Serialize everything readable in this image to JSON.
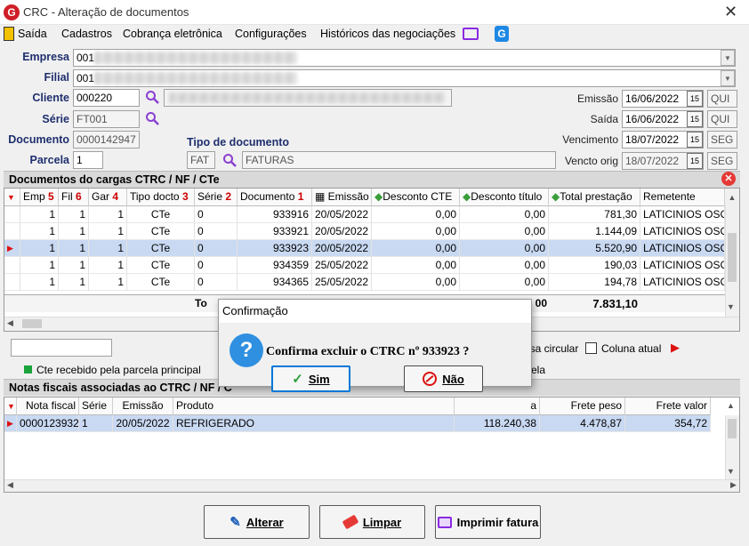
{
  "window": {
    "title": "CRC - Alteração de documentos"
  },
  "menu": [
    {
      "label": "Saída"
    },
    {
      "label": "Cadastros"
    },
    {
      "label": "Cobrança eletrônica"
    },
    {
      "label": "Configurações"
    },
    {
      "label": "Históricos das negociações"
    }
  ],
  "form": {
    "empresa": {
      "label": "Empresa",
      "value": "001"
    },
    "filial": {
      "label": "Filial",
      "value": "001"
    },
    "cliente": {
      "label": "Cliente",
      "value": "000220"
    },
    "serie": {
      "label": "Série",
      "value": "FT001"
    },
    "documento": {
      "label": "Documento",
      "value": "0000142947"
    },
    "parcela": {
      "label": "Parcela",
      "value": "1"
    },
    "tipo_documento": {
      "label": "Tipo de documento",
      "code": "FAT",
      "name": "FATURAS"
    },
    "emissao": {
      "label": "Emissão",
      "date": "16/06/2022",
      "day": "QUI"
    },
    "saida": {
      "label": "Saída",
      "date": "16/06/2022",
      "day": "QUI"
    },
    "vencimento": {
      "label": "Vencimento",
      "date": "18/07/2022",
      "day": "SEG"
    },
    "vencto_orig": {
      "label": "Vencto orig",
      "date": "18/07/2022",
      "day": "SEG"
    }
  },
  "docs_section": {
    "title": "Documentos do cargas CTRC / NF / CTe",
    "columns": [
      "Emp",
      "Fil",
      "Gar",
      "Tipo docto",
      "Série",
      "Documento",
      "Emissão",
      "Desconto CTE",
      "Desconto título",
      "Total prestação",
      "Remetente"
    ],
    "sort_badges": [
      "5",
      "6",
      "4",
      "3",
      "2",
      "1"
    ],
    "rows": [
      [
        "1",
        "1",
        "1",
        "CTe",
        "0",
        "933916",
        "20/05/2022",
        "0,00",
        "0,00",
        "781,30",
        "LATICINIOS OSCA"
      ],
      [
        "1",
        "1",
        "1",
        "CTe",
        "0",
        "933921",
        "20/05/2022",
        "0,00",
        "0,00",
        "1.144,09",
        "LATICINIOS OSCA"
      ],
      [
        "1",
        "1",
        "1",
        "CTe",
        "0",
        "933923",
        "20/05/2022",
        "0,00",
        "0,00",
        "5.520,90",
        "LATICINIOS OSCA"
      ],
      [
        "1",
        "1",
        "1",
        "CTe",
        "0",
        "934359",
        "25/05/2022",
        "0,00",
        "0,00",
        "190,03",
        "LATICINIOS OSCA"
      ],
      [
        "1",
        "1",
        "1",
        "CTe",
        "0",
        "934365",
        "25/05/2022",
        "0,00",
        "0,00",
        "194,78",
        "LATICINIOS OSCA"
      ]
    ],
    "totals": {
      "label_partial": "To",
      "partial_value": "00",
      "total": "7.831,10"
    },
    "search_circular_label": "isa circular",
    "coluna_atual_label": "Coluna atual",
    "legend_text": "Cte recebido pela parcela principal",
    "legend_text_right": "ela"
  },
  "nf_section": {
    "title": "Notas fiscais associadas ao CTRC / NF / C",
    "columns": [
      "Nota fiscal",
      "Série",
      "Emissão",
      "Produto",
      "a",
      "Frete peso",
      "Frete valor"
    ],
    "rows": [
      [
        "0000123932",
        "1",
        "20/05/2022",
        "REFRIGERADO",
        "118.240,38",
        "4.478,87",
        "354,72"
      ]
    ]
  },
  "buttons": {
    "alterar": "Alterar",
    "limpar": "Limpar",
    "imprimir": "Imprimir fatura"
  },
  "dialog": {
    "title": "Confirmação",
    "message": "Confirma excluir o CTRC nº 933923 ?",
    "yes": "Sim",
    "no": "Não"
  },
  "colors": {
    "selected_row": "#c9d9f2",
    "accent": "#1f2f6e",
    "legend_green": "#1aa33a"
  }
}
